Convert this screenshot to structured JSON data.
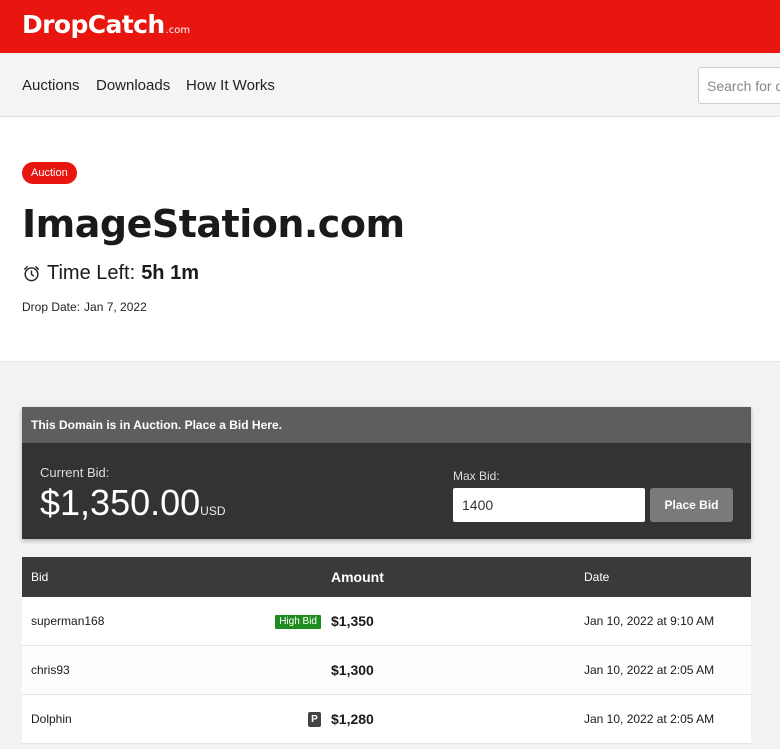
{
  "header": {
    "logo_main": "DropCatch",
    "logo_tld": ".com"
  },
  "nav": {
    "links": [
      "Auctions",
      "Downloads",
      "How It Works"
    ],
    "search_placeholder": "Search for domains"
  },
  "domain": {
    "badge": "Auction",
    "name": "ImageStation.com",
    "time_left_label": "Time Left:",
    "time_left_value": "5h 1m",
    "drop_date_label": "Drop Date:",
    "drop_date_value": "Jan 7, 2022"
  },
  "bid_panel": {
    "heading": "This Domain is in Auction. Place a Bid Here.",
    "current_bid_label": "Current Bid:",
    "current_bid_amount": "$1,350.00",
    "currency": "USD",
    "max_bid_label": "Max Bid:",
    "max_bid_value": "1400",
    "place_bid_label": "Place Bid"
  },
  "bid_table": {
    "columns": [
      "Bid",
      "Amount",
      "Date"
    ],
    "rows": [
      {
        "bidder": "superman168",
        "amount": "$1,350",
        "date": "Jan 10, 2022 at 9:10 AM",
        "tag": "High Bid"
      },
      {
        "bidder": "chris93",
        "amount": "$1,300",
        "date": "Jan 10, 2022 at 2:05 AM"
      },
      {
        "bidder": "Dolphin",
        "amount": "$1,280",
        "date": "Jan 10, 2022 at 2:05 AM",
        "icon_letter": "P"
      }
    ]
  },
  "colors": {
    "brand_red": "#e8160f",
    "panel_dark": "#333333",
    "high_bid_green": "#1e8c1e"
  }
}
